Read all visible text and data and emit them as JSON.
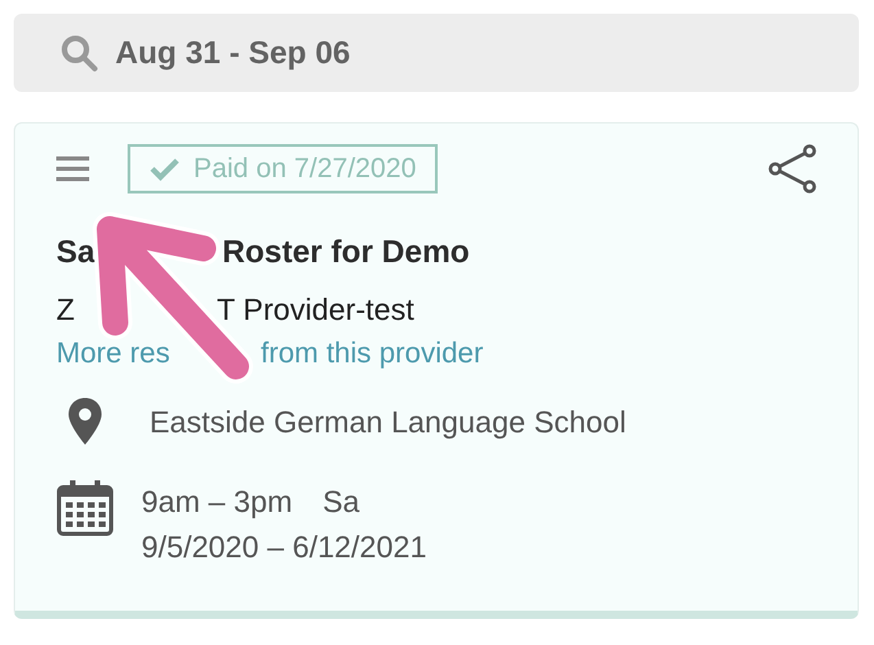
{
  "search": {
    "value": "Aug 31 - Sep 06"
  },
  "card": {
    "status_badge": "Paid on 7/27/2020",
    "title_parts": [
      "Sa",
      "Roster for Demo"
    ],
    "provider_parts": [
      "Z",
      "T Provider-test"
    ],
    "link_parts": [
      "More res",
      "from this provider"
    ],
    "location": "Eastside German Language School",
    "schedule": {
      "time": "9am – 3pm",
      "days": "Sa",
      "dates": "9/5/2020 – 6/12/2021"
    }
  }
}
